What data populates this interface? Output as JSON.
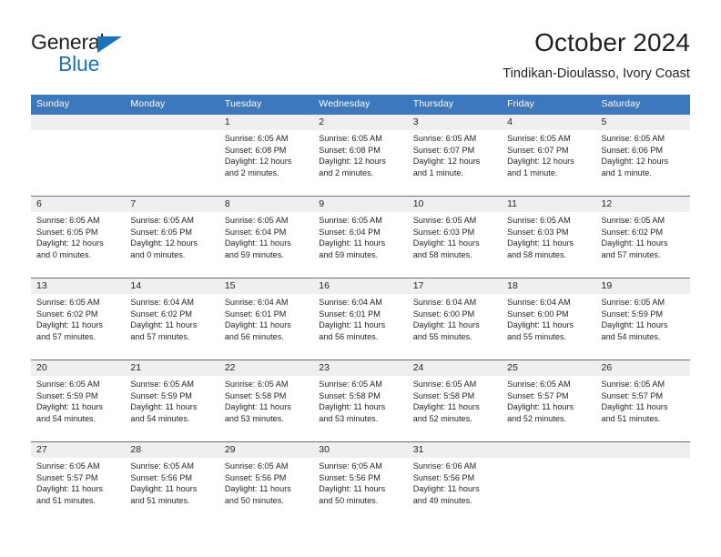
{
  "brand": {
    "name_part1": "General",
    "name_part2": "Blue",
    "triangle_icon": "triangle-logo-icon",
    "accent_color": "#1d71b8"
  },
  "header": {
    "title": "October 2024",
    "subtitle": "Tindikan-Dioulasso, Ivory Coast"
  },
  "theme": {
    "header_blue": "#3b78be",
    "daynum_band": "#efefef",
    "text": "#231f20"
  },
  "weekdays": [
    "Sunday",
    "Monday",
    "Tuesday",
    "Wednesday",
    "Thursday",
    "Friday",
    "Saturday"
  ],
  "weeks": [
    [
      {
        "day": "",
        "lines": []
      },
      {
        "day": "",
        "lines": []
      },
      {
        "day": "1",
        "lines": [
          "Sunrise: 6:05 AM",
          "Sunset: 6:08 PM",
          "Daylight: 12 hours",
          "and 2 minutes."
        ]
      },
      {
        "day": "2",
        "lines": [
          "Sunrise: 6:05 AM",
          "Sunset: 6:08 PM",
          "Daylight: 12 hours",
          "and 2 minutes."
        ]
      },
      {
        "day": "3",
        "lines": [
          "Sunrise: 6:05 AM",
          "Sunset: 6:07 PM",
          "Daylight: 12 hours",
          "and 1 minute."
        ]
      },
      {
        "day": "4",
        "lines": [
          "Sunrise: 6:05 AM",
          "Sunset: 6:07 PM",
          "Daylight: 12 hours",
          "and 1 minute."
        ]
      },
      {
        "day": "5",
        "lines": [
          "Sunrise: 6:05 AM",
          "Sunset: 6:06 PM",
          "Daylight: 12 hours",
          "and 1 minute."
        ]
      }
    ],
    [
      {
        "day": "6",
        "lines": [
          "Sunrise: 6:05 AM",
          "Sunset: 6:05 PM",
          "Daylight: 12 hours",
          "and 0 minutes."
        ]
      },
      {
        "day": "7",
        "lines": [
          "Sunrise: 6:05 AM",
          "Sunset: 6:05 PM",
          "Daylight: 12 hours",
          "and 0 minutes."
        ]
      },
      {
        "day": "8",
        "lines": [
          "Sunrise: 6:05 AM",
          "Sunset: 6:04 PM",
          "Daylight: 11 hours",
          "and 59 minutes."
        ]
      },
      {
        "day": "9",
        "lines": [
          "Sunrise: 6:05 AM",
          "Sunset: 6:04 PM",
          "Daylight: 11 hours",
          "and 59 minutes."
        ]
      },
      {
        "day": "10",
        "lines": [
          "Sunrise: 6:05 AM",
          "Sunset: 6:03 PM",
          "Daylight: 11 hours",
          "and 58 minutes."
        ]
      },
      {
        "day": "11",
        "lines": [
          "Sunrise: 6:05 AM",
          "Sunset: 6:03 PM",
          "Daylight: 11 hours",
          "and 58 minutes."
        ]
      },
      {
        "day": "12",
        "lines": [
          "Sunrise: 6:05 AM",
          "Sunset: 6:02 PM",
          "Daylight: 11 hours",
          "and 57 minutes."
        ]
      }
    ],
    [
      {
        "day": "13",
        "lines": [
          "Sunrise: 6:05 AM",
          "Sunset: 6:02 PM",
          "Daylight: 11 hours",
          "and 57 minutes."
        ]
      },
      {
        "day": "14",
        "lines": [
          "Sunrise: 6:04 AM",
          "Sunset: 6:02 PM",
          "Daylight: 11 hours",
          "and 57 minutes."
        ]
      },
      {
        "day": "15",
        "lines": [
          "Sunrise: 6:04 AM",
          "Sunset: 6:01 PM",
          "Daylight: 11 hours",
          "and 56 minutes."
        ]
      },
      {
        "day": "16",
        "lines": [
          "Sunrise: 6:04 AM",
          "Sunset: 6:01 PM",
          "Daylight: 11 hours",
          "and 56 minutes."
        ]
      },
      {
        "day": "17",
        "lines": [
          "Sunrise: 6:04 AM",
          "Sunset: 6:00 PM",
          "Daylight: 11 hours",
          "and 55 minutes."
        ]
      },
      {
        "day": "18",
        "lines": [
          "Sunrise: 6:04 AM",
          "Sunset: 6:00 PM",
          "Daylight: 11 hours",
          "and 55 minutes."
        ]
      },
      {
        "day": "19",
        "lines": [
          "Sunrise: 6:05 AM",
          "Sunset: 5:59 PM",
          "Daylight: 11 hours",
          "and 54 minutes."
        ]
      }
    ],
    [
      {
        "day": "20",
        "lines": [
          "Sunrise: 6:05 AM",
          "Sunset: 5:59 PM",
          "Daylight: 11 hours",
          "and 54 minutes."
        ]
      },
      {
        "day": "21",
        "lines": [
          "Sunrise: 6:05 AM",
          "Sunset: 5:59 PM",
          "Daylight: 11 hours",
          "and 54 minutes."
        ]
      },
      {
        "day": "22",
        "lines": [
          "Sunrise: 6:05 AM",
          "Sunset: 5:58 PM",
          "Daylight: 11 hours",
          "and 53 minutes."
        ]
      },
      {
        "day": "23",
        "lines": [
          "Sunrise: 6:05 AM",
          "Sunset: 5:58 PM",
          "Daylight: 11 hours",
          "and 53 minutes."
        ]
      },
      {
        "day": "24",
        "lines": [
          "Sunrise: 6:05 AM",
          "Sunset: 5:58 PM",
          "Daylight: 11 hours",
          "and 52 minutes."
        ]
      },
      {
        "day": "25",
        "lines": [
          "Sunrise: 6:05 AM",
          "Sunset: 5:57 PM",
          "Daylight: 11 hours",
          "and 52 minutes."
        ]
      },
      {
        "day": "26",
        "lines": [
          "Sunrise: 6:05 AM",
          "Sunset: 5:57 PM",
          "Daylight: 11 hours",
          "and 51 minutes."
        ]
      }
    ],
    [
      {
        "day": "27",
        "lines": [
          "Sunrise: 6:05 AM",
          "Sunset: 5:57 PM",
          "Daylight: 11 hours",
          "and 51 minutes."
        ]
      },
      {
        "day": "28",
        "lines": [
          "Sunrise: 6:05 AM",
          "Sunset: 5:56 PM",
          "Daylight: 11 hours",
          "and 51 minutes."
        ]
      },
      {
        "day": "29",
        "lines": [
          "Sunrise: 6:05 AM",
          "Sunset: 5:56 PM",
          "Daylight: 11 hours",
          "and 50 minutes."
        ]
      },
      {
        "day": "30",
        "lines": [
          "Sunrise: 6:05 AM",
          "Sunset: 5:56 PM",
          "Daylight: 11 hours",
          "and 50 minutes."
        ]
      },
      {
        "day": "31",
        "lines": [
          "Sunrise: 6:06 AM",
          "Sunset: 5:56 PM",
          "Daylight: 11 hours",
          "and 49 minutes."
        ]
      },
      {
        "day": "",
        "lines": []
      },
      {
        "day": "",
        "lines": []
      }
    ]
  ]
}
